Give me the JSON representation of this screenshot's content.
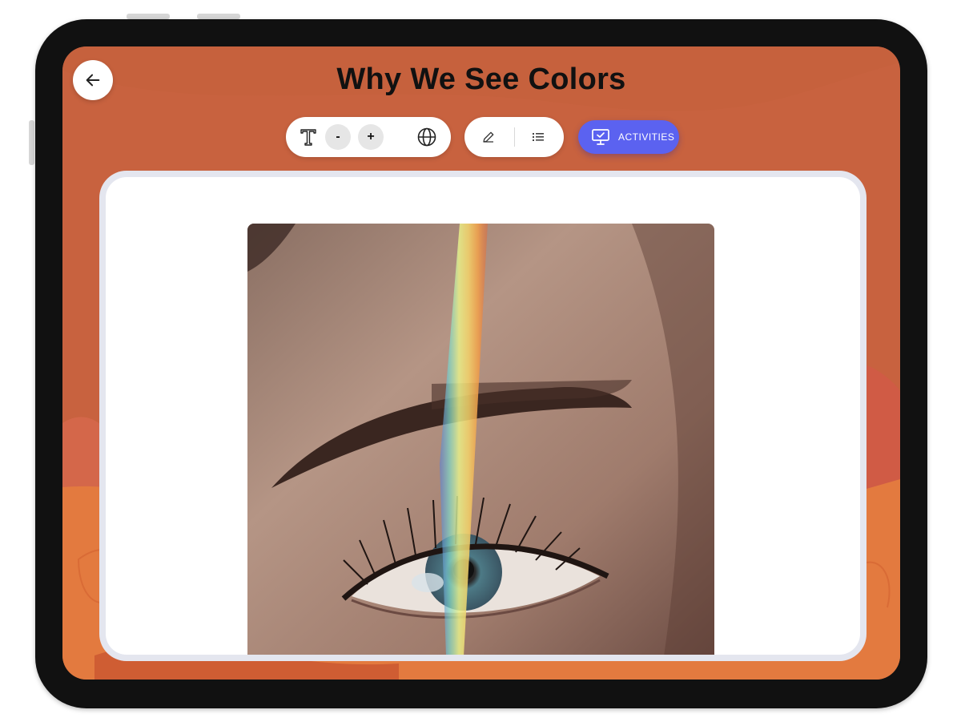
{
  "header": {
    "title": "Why We See Colors"
  },
  "toolbar": {
    "decrease_label": "-",
    "increase_label": "+",
    "activities_label": "ACTIVITIES"
  },
  "colors": {
    "background": "#c8623f",
    "accent": "#5b62f0",
    "device": "#111111"
  },
  "icons": {
    "back": "arrow-left-icon",
    "text_size": "text-size-icon",
    "language": "globe-icon",
    "annotate": "pencil-icon",
    "list": "list-icon",
    "activities": "monitor-check-icon"
  }
}
